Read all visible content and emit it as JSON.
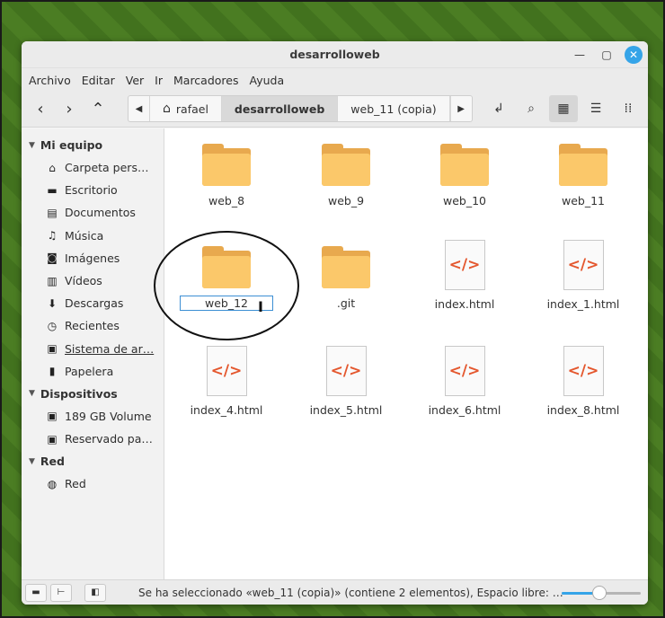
{
  "window": {
    "title": "desarrolloweb"
  },
  "menubar": {
    "items": [
      "Archivo",
      "Editar",
      "Ver",
      "Ir",
      "Marcadores",
      "Ayuda"
    ]
  },
  "pathbar": {
    "crumbs": [
      "rafael",
      "desarrolloweb",
      "web_11 (copia)"
    ],
    "active_index": 1
  },
  "sidebar": {
    "sections": [
      {
        "title": "Mi equipo",
        "items": [
          {
            "label": "Carpeta pers…",
            "icon": "home-icon"
          },
          {
            "label": "Escritorio",
            "icon": "desktop-icon"
          },
          {
            "label": "Documentos",
            "icon": "documents-icon"
          },
          {
            "label": "Música",
            "icon": "music-icon"
          },
          {
            "label": "Imágenes",
            "icon": "pictures-icon"
          },
          {
            "label": "Vídeos",
            "icon": "videos-icon"
          },
          {
            "label": "Descargas",
            "icon": "downloads-icon"
          },
          {
            "label": "Recientes",
            "icon": "recent-icon"
          },
          {
            "label": "Sistema de ar…",
            "icon": "filesystem-icon"
          },
          {
            "label": "Papelera",
            "icon": "trash-icon"
          }
        ]
      },
      {
        "title": "Dispositivos",
        "items": [
          {
            "label": "189 GB Volume",
            "icon": "drive-icon"
          },
          {
            "label": "Reservado pa…",
            "icon": "drive-icon"
          }
        ]
      },
      {
        "title": "Red",
        "items": [
          {
            "label": "Red",
            "icon": "network-icon"
          }
        ]
      }
    ]
  },
  "files": [
    {
      "name": "web_8",
      "type": "folder"
    },
    {
      "name": "web_9",
      "type": "folder"
    },
    {
      "name": "web_10",
      "type": "folder"
    },
    {
      "name": "web_11",
      "type": "folder"
    },
    {
      "name": "web_12",
      "type": "folder",
      "renaming": true
    },
    {
      "name": ".git",
      "type": "folder"
    },
    {
      "name": "index.html",
      "type": "html"
    },
    {
      "name": "index_1.html",
      "type": "html"
    },
    {
      "name": "index_4.html",
      "type": "html"
    },
    {
      "name": "index_5.html",
      "type": "html"
    },
    {
      "name": "index_6.html",
      "type": "html"
    },
    {
      "name": "index_8.html",
      "type": "html"
    }
  ],
  "html_icon_glyph": "</>",
  "status": {
    "text": "Se ha seleccionado «web_11 (copia)» (contiene 2 elementos), Espacio libre: …",
    "zoom_level": 0.48
  },
  "colors": {
    "accent": "#35a4e8",
    "folder": "#fbc86a",
    "html_tag": "#e4572e"
  }
}
